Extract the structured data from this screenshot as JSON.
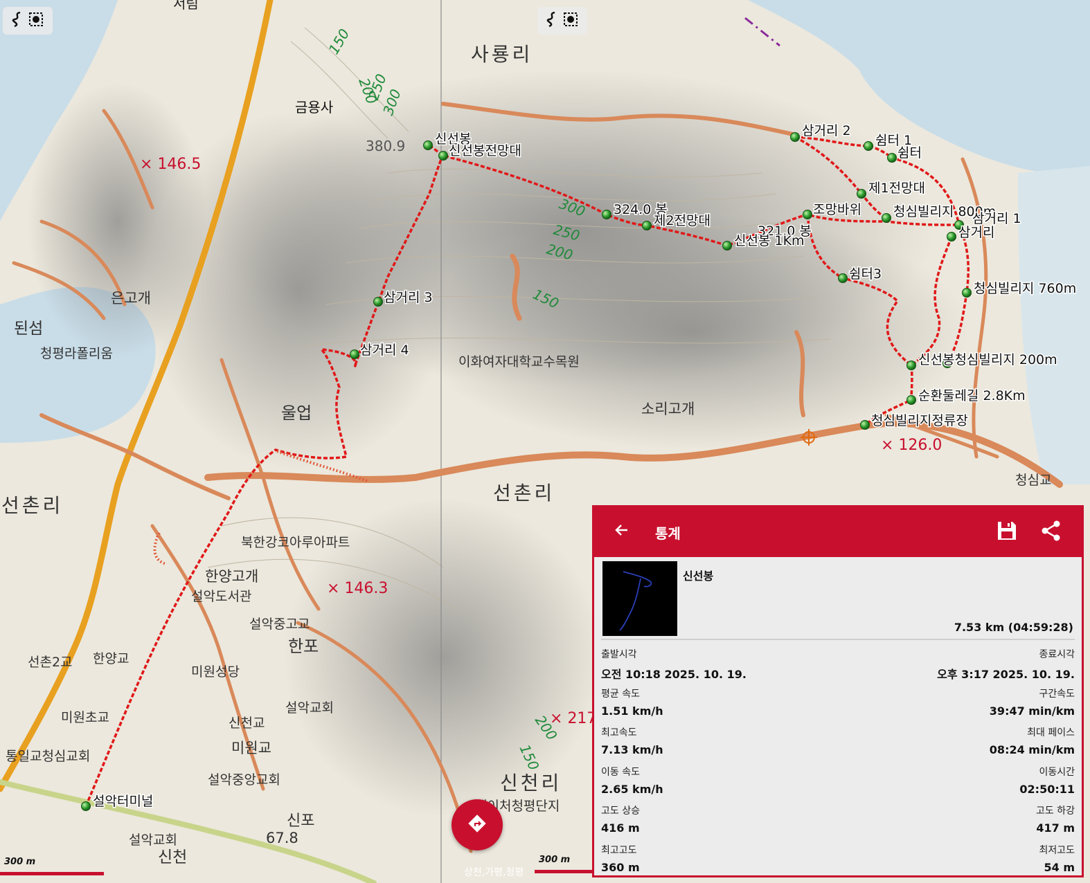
{
  "map": {
    "labels": {
      "sim": "서림",
      "geumyongsa": "금용사",
      "sayongri": "사룡리",
      "elev_380": "380.9",
      "sinseonbong": "신선봉",
      "sinseonbong_view": "신선봉전망대",
      "h1465": "146.5",
      "samgeori2": "삼거리 2",
      "shelter1": "쉼터 1",
      "shelter": "쉼터",
      "view1": "제1전망대",
      "peak324": "324.0 봉",
      "view2": "제2전망대",
      "jomangbawi": "조망바위",
      "cheongsim800": "청심빌리지 800m",
      "samgeori1": "삼거리 1",
      "peak321": "321.0 봉",
      "sinseon1km": "신선봉 1Km",
      "samgeori": "삼거리",
      "shelter3": "쉼터3",
      "cheongsim760": "청심빌리지 760m",
      "samgeori3": "삼거리 3",
      "samgeori4": "삼거리 4",
      "eungogae": "은고개",
      "doeseom": "된섬",
      "cheongpyeong": "청평라폴리움",
      "ewha": "이화여자대학교수목원",
      "uleop": "울업",
      "sinseon_cheongsim200": "신선봉청심빌리지 200m",
      "sunhwan": "순환둘레길 2.8Km",
      "cheongsim_stop": "청심빌리지정류장",
      "sorigogae": "소리고개",
      "h1260": "126.0",
      "cheongsimgyo": "청심교",
      "seonchonri_w": "선촌리",
      "seonchonri_c": "선촌리",
      "bukhangang": "북한강코아루아파트",
      "hanyanggogae": "한양고개",
      "seorakdoseogwan": "설악도서관",
      "h1463": "146.3",
      "seorakjung": "설악중고교",
      "hanpo": "한포",
      "seonchon2": "선촌2교",
      "hanyanggyo": "한양교",
      "miwonseong": "미원성당",
      "miwoncho": "미원초교",
      "seorakgyohoe": "설악교회",
      "sincheongyo": "신천교",
      "miwongyo": "미원교",
      "h217": "217",
      "tongil": "통일교청심교회",
      "seorakjungang": "설악중앙교회",
      "sincheonri": "신천리",
      "seorakterminal": "설악터미널",
      "nature": "네이처청평단지",
      "sinpo": "신포",
      "h678": "67.8",
      "seorakgyohoe2": "설악교회",
      "sincheon": "신천",
      "road_bottom": "상천,가평,청평",
      "c150a": "150",
      "c200a": "200",
      "c250a": "250",
      "c300a": "300",
      "c300b": "300",
      "c250b": "250",
      "c200b": "200",
      "c150b": "150",
      "c200c": "200",
      "c150c": "150"
    },
    "scale_left": "300 m",
    "scale_right": "300 m",
    "colors": {
      "route": "#e01818",
      "waypoint": "#2e9e2e",
      "contour_label": "#1f8a3a",
      "elev_label": "#c8102e"
    }
  },
  "stats": {
    "header": {
      "title": "통계",
      "back_icon": "arrow-left",
      "save_icon": "floppy",
      "share_icon": "share"
    },
    "name": "신선봉",
    "total": "7.53 km (04:59:28)",
    "rows": [
      {
        "l_label": "출발시각",
        "l_value": "오전 10:18 2025. 10. 19.",
        "r_label": "종료시각",
        "r_value": "오후 3:17 2025. 10. 19."
      },
      {
        "l_label": "평균 속도",
        "l_value": "1.51 km/h",
        "r_label": "구간속도",
        "r_value": "39:47 min/km"
      },
      {
        "l_label": "최고속도",
        "l_value": "7.13 km/h",
        "r_label": "최대 페이스",
        "r_value": "08:24 min/km"
      },
      {
        "l_label": "이동 속도",
        "l_value": "2.65 km/h",
        "r_label": "이동시간",
        "r_value": "02:50:11"
      },
      {
        "l_label": "고도 상승",
        "l_value": "416 m",
        "r_label": "고도 하강",
        "r_value": "417 m"
      },
      {
        "l_label": "최고고도",
        "l_value": "360 m",
        "r_label": "최저고도",
        "r_value": "54 m"
      }
    ]
  }
}
